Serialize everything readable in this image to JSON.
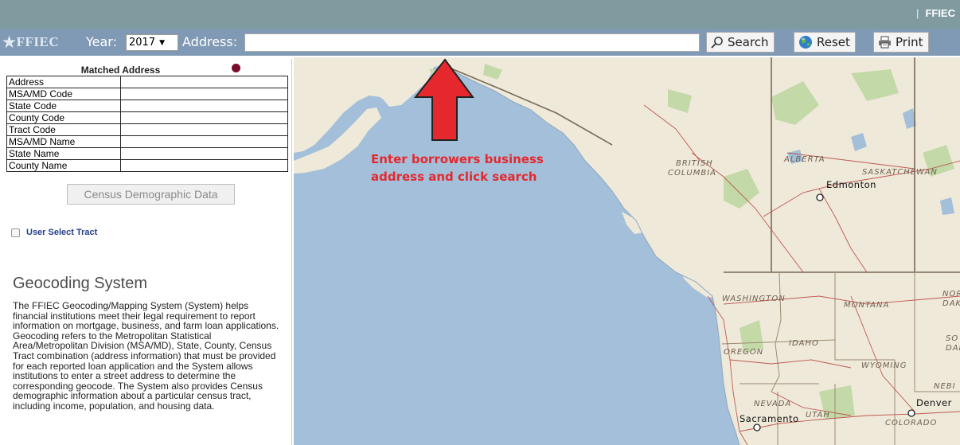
{
  "header": {
    "brand": "FFIEC"
  },
  "toolbar": {
    "logo_text": "FFIEC",
    "year_label": "Year:",
    "year_value": "2017",
    "address_label": "Address:",
    "address_value": "",
    "search_label": "Search",
    "reset_label": "Reset",
    "print_label": "Print"
  },
  "matched_address": {
    "title": "Matched Address",
    "rows": [
      {
        "label": "Address",
        "value": ""
      },
      {
        "label": "MSA/MD Code",
        "value": ""
      },
      {
        "label": "State Code",
        "value": ""
      },
      {
        "label": "County Code",
        "value": ""
      },
      {
        "label": "Tract Code",
        "value": ""
      },
      {
        "label": "MSA/MD Name",
        "value": ""
      },
      {
        "label": "State Name",
        "value": ""
      },
      {
        "label": "County Name",
        "value": ""
      }
    ]
  },
  "census_button": "Census Demographic Data",
  "user_select_tract": {
    "label": "User Select Tract",
    "checked": false
  },
  "geocoding": {
    "heading": "Geocoding System",
    "paragraph": "The FFIEC Geocoding/Mapping System (System) helps financial institutions meet their legal requirement to report information on mortgage, business, and farm loan applications. Geocoding refers to the Metropolitan Statistical Area/Metropolitan Division (MSA/MD), State, County, Census Tract combination (address information) that must be provided for each reported loan application and the System allows institutions to enter a street address to determine the corresponding geocode. The System also provides Census demographic information about a particular census tract, including income, population, and housing data."
  },
  "annotation": {
    "line1": "Enter borrowers business",
    "line2": "address and click search",
    "color": "#e5282e"
  },
  "map": {
    "labels": {
      "british_columbia_1": "BRITISH",
      "british_columbia_2": "COLUMBIA",
      "alberta": "ALBERTA",
      "saskatchewan": "SASKATCHEWAN",
      "edmonton": "Edmonton",
      "washington": "WASHINGTON",
      "montana": "MONTANA",
      "north_dakota_1": "NOR",
      "north_dakota_2": "DAK",
      "idaho": "IDAHO",
      "oregon": "OREGON",
      "south_dakota_1": "SO",
      "south_dakota_2": "DAK",
      "wyoming": "WYOMING",
      "nebraska": "NEBI",
      "nevada": "NEVADA",
      "sacramento": "Sacramento",
      "utah": "UTAH",
      "colorado": "COLORADO",
      "denver": "Denver"
    },
    "colors": {
      "water": "#a3bfd9",
      "land": "#efe9da",
      "park": "#c4d9a8",
      "roads": "#b5413b",
      "border": "#7a6a55"
    }
  }
}
